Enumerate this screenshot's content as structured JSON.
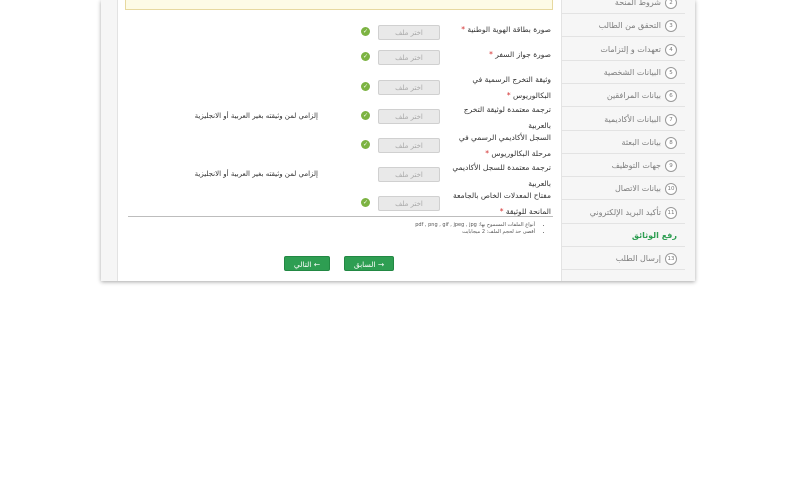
{
  "form": {
    "file_button_label": "اختر ملف",
    "required_mark": "*",
    "rows": [
      {
        "label": "صورة بطاقة الهوية الوطنية",
        "required": "*",
        "checked": true,
        "note": ""
      },
      {
        "label": "صورة جواز السفر",
        "required": "*",
        "checked": true,
        "note": ""
      },
      {
        "label": "وثيقة التخرج الرسمية في البكالوريوس",
        "required": "*",
        "checked": true,
        "note": ""
      },
      {
        "label": "ترجمة معتمدة لوثيقة التخرج بالعربية",
        "required": "",
        "checked": true,
        "note": "إلزامي لمن وثيقته بغير العربية أو الانجليزية"
      },
      {
        "label": "السجل الأكاديمي الرسمي في مرحلة البكالوريوس",
        "required": "*",
        "checked": true,
        "note": ""
      },
      {
        "label": "ترجمة معتمدة للسجل الأكاديمي بالعربية",
        "required": "",
        "checked": false,
        "note": "إلزامي لمن وثيقته بغير العربية أو الانجليزية"
      },
      {
        "label": "مفتاح المعدلات الخاص بالجامعة المانحة للوثيقة",
        "required": "*",
        "checked": true,
        "note": ""
      }
    ],
    "hints": [
      "أنواع الملفات المسموح بها: pdf , png , gif , jpeg , jpg",
      "أقصى حد لحجم الملف: 2 ميجابايت"
    ]
  },
  "nav": {
    "prev_label": "السابق →",
    "next_label": "التالي ←"
  },
  "sidebar": {
    "items": [
      {
        "num": "2",
        "label": "شروط المنحة",
        "active": false
      },
      {
        "num": "3",
        "label": "التحقق من الطالب",
        "active": false
      },
      {
        "num": "4",
        "label": "تعهدات و إلتزامات",
        "active": false
      },
      {
        "num": "5",
        "label": "البيانات الشخصية",
        "active": false
      },
      {
        "num": "6",
        "label": "بيانات المرافقين",
        "active": false
      },
      {
        "num": "7",
        "label": "البيانات الأكاديمية",
        "active": false
      },
      {
        "num": "8",
        "label": "بيانات البعثة",
        "active": false
      },
      {
        "num": "9",
        "label": "جهات التوظيف",
        "active": false
      },
      {
        "num": "10",
        "label": "بيانات الاتصال",
        "active": false
      },
      {
        "num": "11",
        "label": "تأكيد البريد الإلكتروني",
        "active": false
      },
      {
        "num": "",
        "label": "رفع الوثائق",
        "active": true
      },
      {
        "num": "13",
        "label": "إرسال الطلب",
        "active": false
      }
    ]
  },
  "colors": {
    "accent_green": "#2e9e52",
    "check_green": "#7cb342",
    "required_red": "#d32f2f"
  }
}
